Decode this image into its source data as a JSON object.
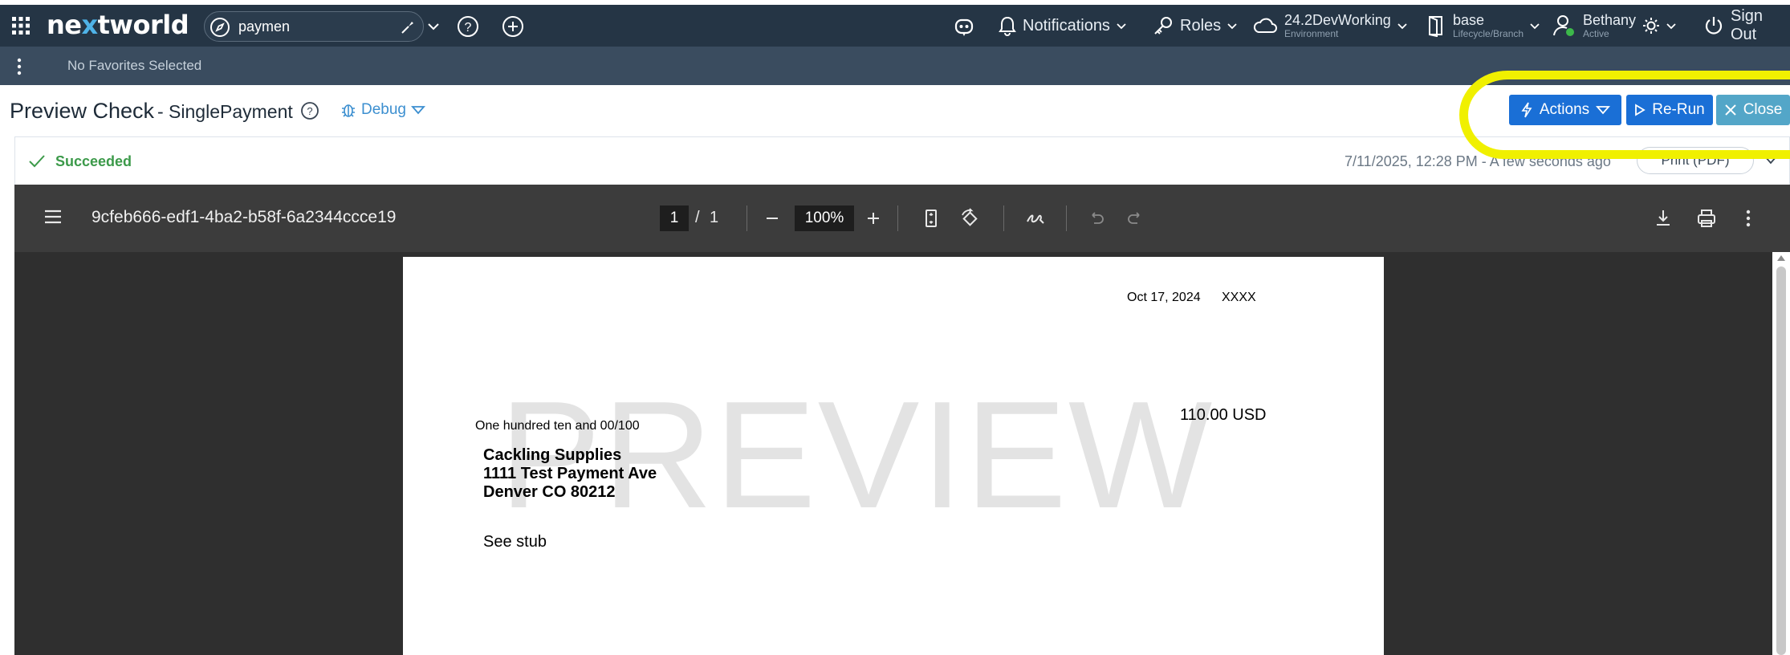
{
  "topbar": {
    "logo_pre": "ne",
    "logo_x": "x",
    "logo_post": "tworld",
    "search_value": "paymen",
    "notifications": "Notifications",
    "roles": "Roles",
    "environment": {
      "main": "24.2DevWorking",
      "sub": "Environment"
    },
    "lifecycle": {
      "main": "base",
      "sub": "Lifecycle/Branch"
    },
    "user": {
      "main": "Bethany",
      "sub": "Active"
    },
    "sign_out": "Sign Out"
  },
  "favorites": {
    "label": "No Favorites Selected"
  },
  "header": {
    "title": "Preview Check",
    "subtitle": "- SinglePayment",
    "debug": "Debug",
    "actions": "Actions",
    "rerun": "Re-Run",
    "close": "Close"
  },
  "status": {
    "text": "Succeeded",
    "timestamp": "7/11/2025, 12:28 PM - A few seconds ago",
    "print": "Print (PDF)"
  },
  "pdf_viewer": {
    "filename": "9cfeb666-edf1-4ba2-b58f-6a2344ccce19",
    "page_current": "1",
    "page_sep": "/",
    "page_total": "1",
    "zoom": "100%"
  },
  "check": {
    "watermark": "PREVIEW",
    "date": "Oct 17, 2024",
    "check_number": "XXXX",
    "amount": "110.00 USD",
    "amount_words": "One hundred ten and 00/100",
    "payee_line1": "Cackling Supplies",
    "payee_line2": "1111 Test Payment Ave",
    "payee_line3": "Denver CO 80212",
    "memo": "See stub"
  },
  "colors": {
    "topbar": "#253545",
    "favbar": "#3a4c5f",
    "primary_button": "#1a6fd6",
    "close_button": "#53a6c8",
    "success": "#3c9a4a",
    "highlight": "#f0f000"
  }
}
